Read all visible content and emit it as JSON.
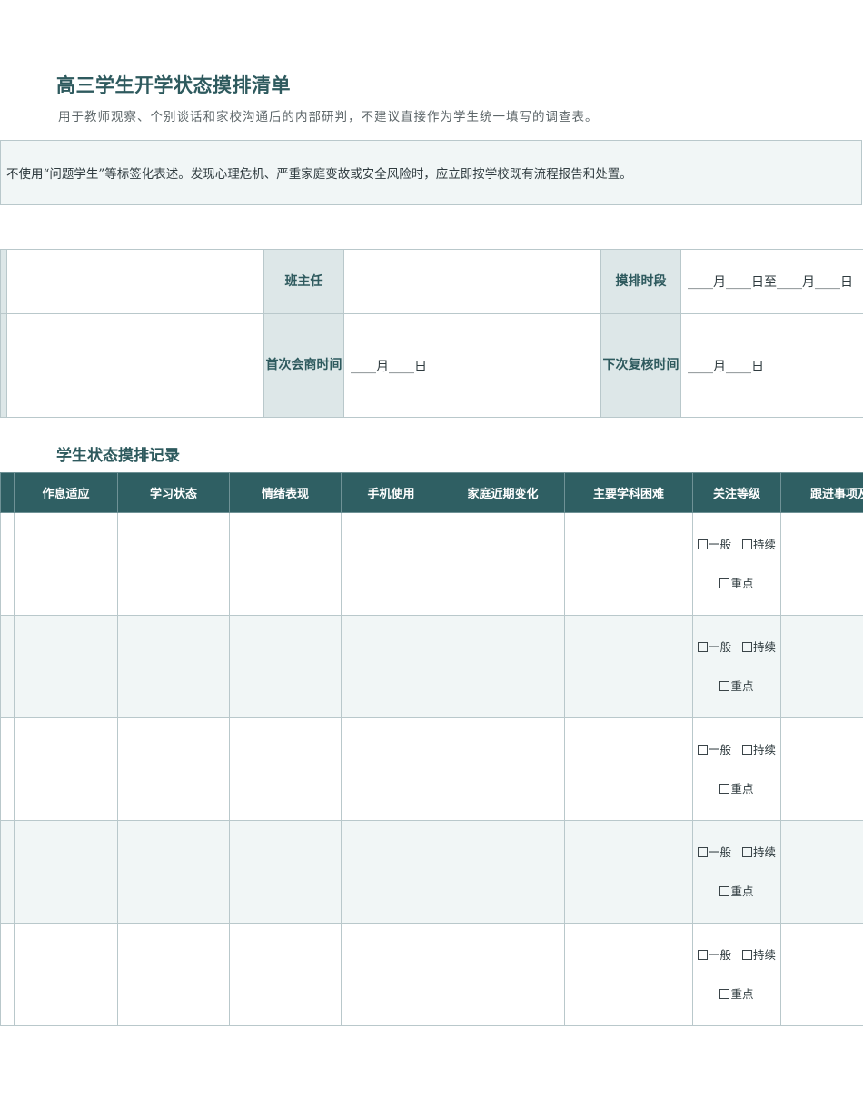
{
  "doc": {
    "title": "高三学生开学状态摸排清单",
    "subtitle": "用于教师观察、个别谈话和家校沟通后的内部研判，不建议直接作为学生统一填写的调查表。",
    "notice": "不使用“问题学生”等标签化表述。发现心理危机、严重家庭变故或安全风险时，应立即按学校既有流程报告和处置。"
  },
  "info": {
    "teacher_label": "班主任",
    "period_label": "摸排时段",
    "period_value": "____月____日至____月____日",
    "first_meeting_label": "首次会商时间",
    "first_meeting_value": "____月____日",
    "next_review_label": "下次复核时间",
    "next_review_value": "____月____日"
  },
  "records": {
    "section_title": "学生状态摸排记录",
    "columns": [
      "作息适应",
      "学习状态",
      "情绪表现",
      "手机使用",
      "家庭近期变化",
      "主要学科困难",
      "关注等级",
      "跟进事项及"
    ],
    "level_options": [
      "一般",
      "持续",
      "重点"
    ],
    "row_count": 5
  }
}
